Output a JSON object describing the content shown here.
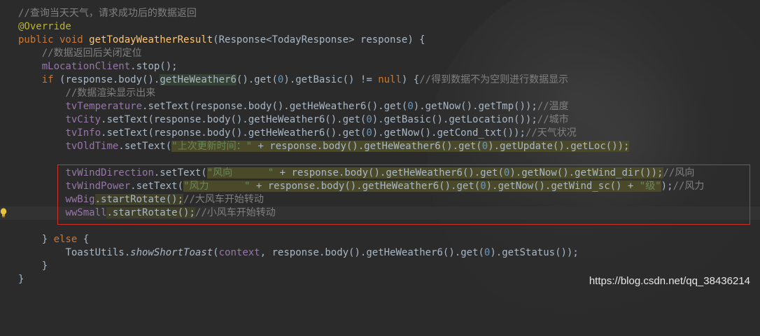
{
  "code": {
    "l1_comment": "//查询当天天气，请求成功后的数据返回",
    "l2_annotation": "@Override",
    "l3_kw": "public void ",
    "l3_method": "getTodayWeatherResult",
    "l3_rest": "(Response<TodayResponse> response) {",
    "l4_comment": "//数据返回后关闭定位",
    "l5_field": "mLocationClient",
    "l5_rest": ".stop();",
    "l6_kw": "if ",
    "l6_a": "(response.body().",
    "l6_hl": "getHeWeather6",
    "l6_b": "().get(",
    "l6_num": "0",
    "l6_c": ").getBasic() != ",
    "l6_null": "null",
    "l6_d": ") {",
    "l6_comment": "//得到数据不为空则进行数据显示",
    "l7_comment": "//数据渲染显示出来",
    "l8_field": "tvTemperature",
    "l8_a": ".setText(response.body().getHeWeather6().get(",
    "l8_num": "0",
    "l8_b": ").getNow().getTmp());",
    "l8_comment": "//温度",
    "l9_field": "tvCity",
    "l9_a": ".setText(response.body().getHeWeather6().get(",
    "l9_num": "0",
    "l9_b": ").getBasic().getLocation());",
    "l9_comment": "//城市",
    "l10_field": "tvInfo",
    "l10_a": ".setText(response.body().getHeWeather6().get(",
    "l10_num": "0",
    "l10_b": ").getNow().getCond_txt());",
    "l10_comment": "//天气状况",
    "l11_field": "tvOldTime",
    "l11_a": ".setText(",
    "l11_str": "\"上次更新时间：\"",
    "l11_b": " + response.body().getHeWeather6().get(",
    "l11_num": "0",
    "l11_c": ").getUpdate().getLoc());",
    "l13_field": "tvWindDirection",
    "l13_a": ".setText(",
    "l13_str": "\"风向      \"",
    "l13_b": " + response.body().getHeWeather6().get(",
    "l13_num": "0",
    "l13_c": ").getNow().getWind_dir());",
    "l13_comment": "//风向",
    "l14_field": "tvWindPower",
    "l14_a": ".setText(",
    "l14_str": "\"风力      \"",
    "l14_b": " + response.body().getHeWeather6().get(",
    "l14_num": "0",
    "l14_c": ").getNow().getWind_sc() + ",
    "l14_str2": "\"级\"",
    "l14_d": ");",
    "l14_comment": "//风力",
    "l15_field": "wwBig",
    "l15_a": ".startRotate();",
    "l15_comment": "//大风车开始转动",
    "l16_field": "wwSmall",
    "l16_a": ".startRotate();",
    "l16_comment": "//小风车开始转动",
    "l18_a": "} ",
    "l18_kw": "else",
    "l18_b": " {",
    "l19_a": "ToastUtils.",
    "l19_italic": "showShortToast",
    "l19_b": "(",
    "l19_field": "context",
    "l19_c": ", response.body().getHeWeather6().get(",
    "l19_num": "0",
    "l19_d": ").getStatus());",
    "l20": "}",
    "l21": "}"
  },
  "watermark": "https://blog.csdn.net/qq_38436214",
  "colors": {
    "background": "#2b2b2b",
    "comment": "#808080",
    "keyword": "#cc7832",
    "string": "#6a8759",
    "number": "#6897bb",
    "field": "#9876aa",
    "method": "#ffc66d",
    "annotation": "#bbb529",
    "selection_border": "#d0312d"
  },
  "icons": {
    "gutter": "lightbulb-icon"
  }
}
